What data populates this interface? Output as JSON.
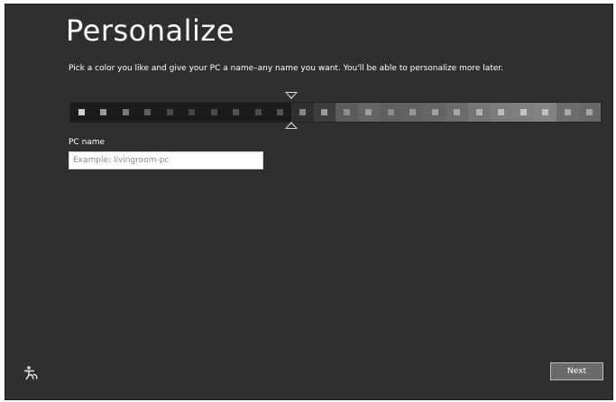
{
  "page": {
    "title": "Personalize",
    "subtitle": "Pick a color you like and give your PC a name–any name you want. You'll be able to personalize more later."
  },
  "color_picker": {
    "selected_index": 10,
    "swatches": [
      {
        "bg": "#1b1b1b",
        "dot": "#cfcfcf"
      },
      {
        "bg": "#1b1b1b",
        "dot": "#9a9a9a"
      },
      {
        "bg": "#1b1b1b",
        "dot": "#7a7a7a"
      },
      {
        "bg": "#1b1b1b",
        "dot": "#5e5e5e"
      },
      {
        "bg": "#1b1b1b",
        "dot": "#4a4a4a"
      },
      {
        "bg": "#1b1b1b",
        "dot": "#454545"
      },
      {
        "bg": "#1b1b1b",
        "dot": "#4c4c4c"
      },
      {
        "bg": "#1b1b1b",
        "dot": "#525252"
      },
      {
        "bg": "#1b1b1b",
        "dot": "#4a4a4a"
      },
      {
        "bg": "#1b1b1b",
        "dot": "#535353"
      },
      {
        "bg": "#2f2f2f",
        "dot": "#858585"
      },
      {
        "bg": "#3d3d3d",
        "dot": "#9a9a9a"
      },
      {
        "bg": "#5c5c5c",
        "dot": "#8f8f8f"
      },
      {
        "bg": "#656565",
        "dot": "#9d9d9d"
      },
      {
        "bg": "#5f5f5f",
        "dot": "#8a8a8a"
      },
      {
        "bg": "#626262",
        "dot": "#969696"
      },
      {
        "bg": "#656565",
        "dot": "#a0a0a0"
      },
      {
        "bg": "#6b6b6b",
        "dot": "#a8a8a8"
      },
      {
        "bg": "#757575",
        "dot": "#b3b3b3"
      },
      {
        "bg": "#7b7b7b",
        "dot": "#bbbbbb"
      },
      {
        "bg": "#7f7f7f",
        "dot": "#c3c3c3"
      },
      {
        "bg": "#838383",
        "dot": "#c0c0c0"
      },
      {
        "bg": "#6d6d6d",
        "dot": "#a9a9a9"
      },
      {
        "bg": "#686868",
        "dot": "#a4a4a4"
      }
    ]
  },
  "pc_name": {
    "label": "PC name",
    "placeholder": "Example: livingroom-pc",
    "value": ""
  },
  "footer": {
    "ease_of_access_icon": "ease-of-access-icon",
    "next_label": "Next"
  }
}
